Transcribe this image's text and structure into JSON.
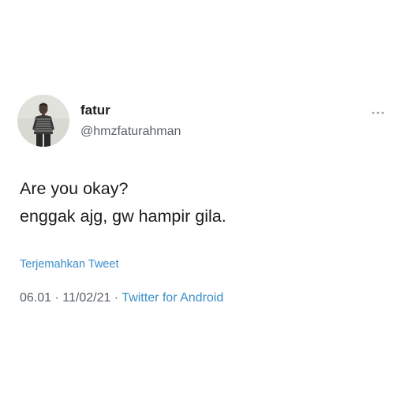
{
  "tweet": {
    "author": {
      "display_name": "fatur",
      "handle": "@hmzfaturahman",
      "avatar_icon": "profile-photo"
    },
    "more_icon": "more-options-icon",
    "text_lines": [
      "Are you okay?",
      "enggak ajg, gw hampir gila."
    ],
    "translate_label": "Terjemahkan Tweet",
    "meta": {
      "time": "06.01",
      "separator": " · ",
      "date": "11/02/21",
      "source": "Twitter for Android"
    }
  },
  "colors": {
    "link": "#3a8ec8",
    "text": "#1c1c1c",
    "secondary": "#586068",
    "background": "#ffffff"
  }
}
